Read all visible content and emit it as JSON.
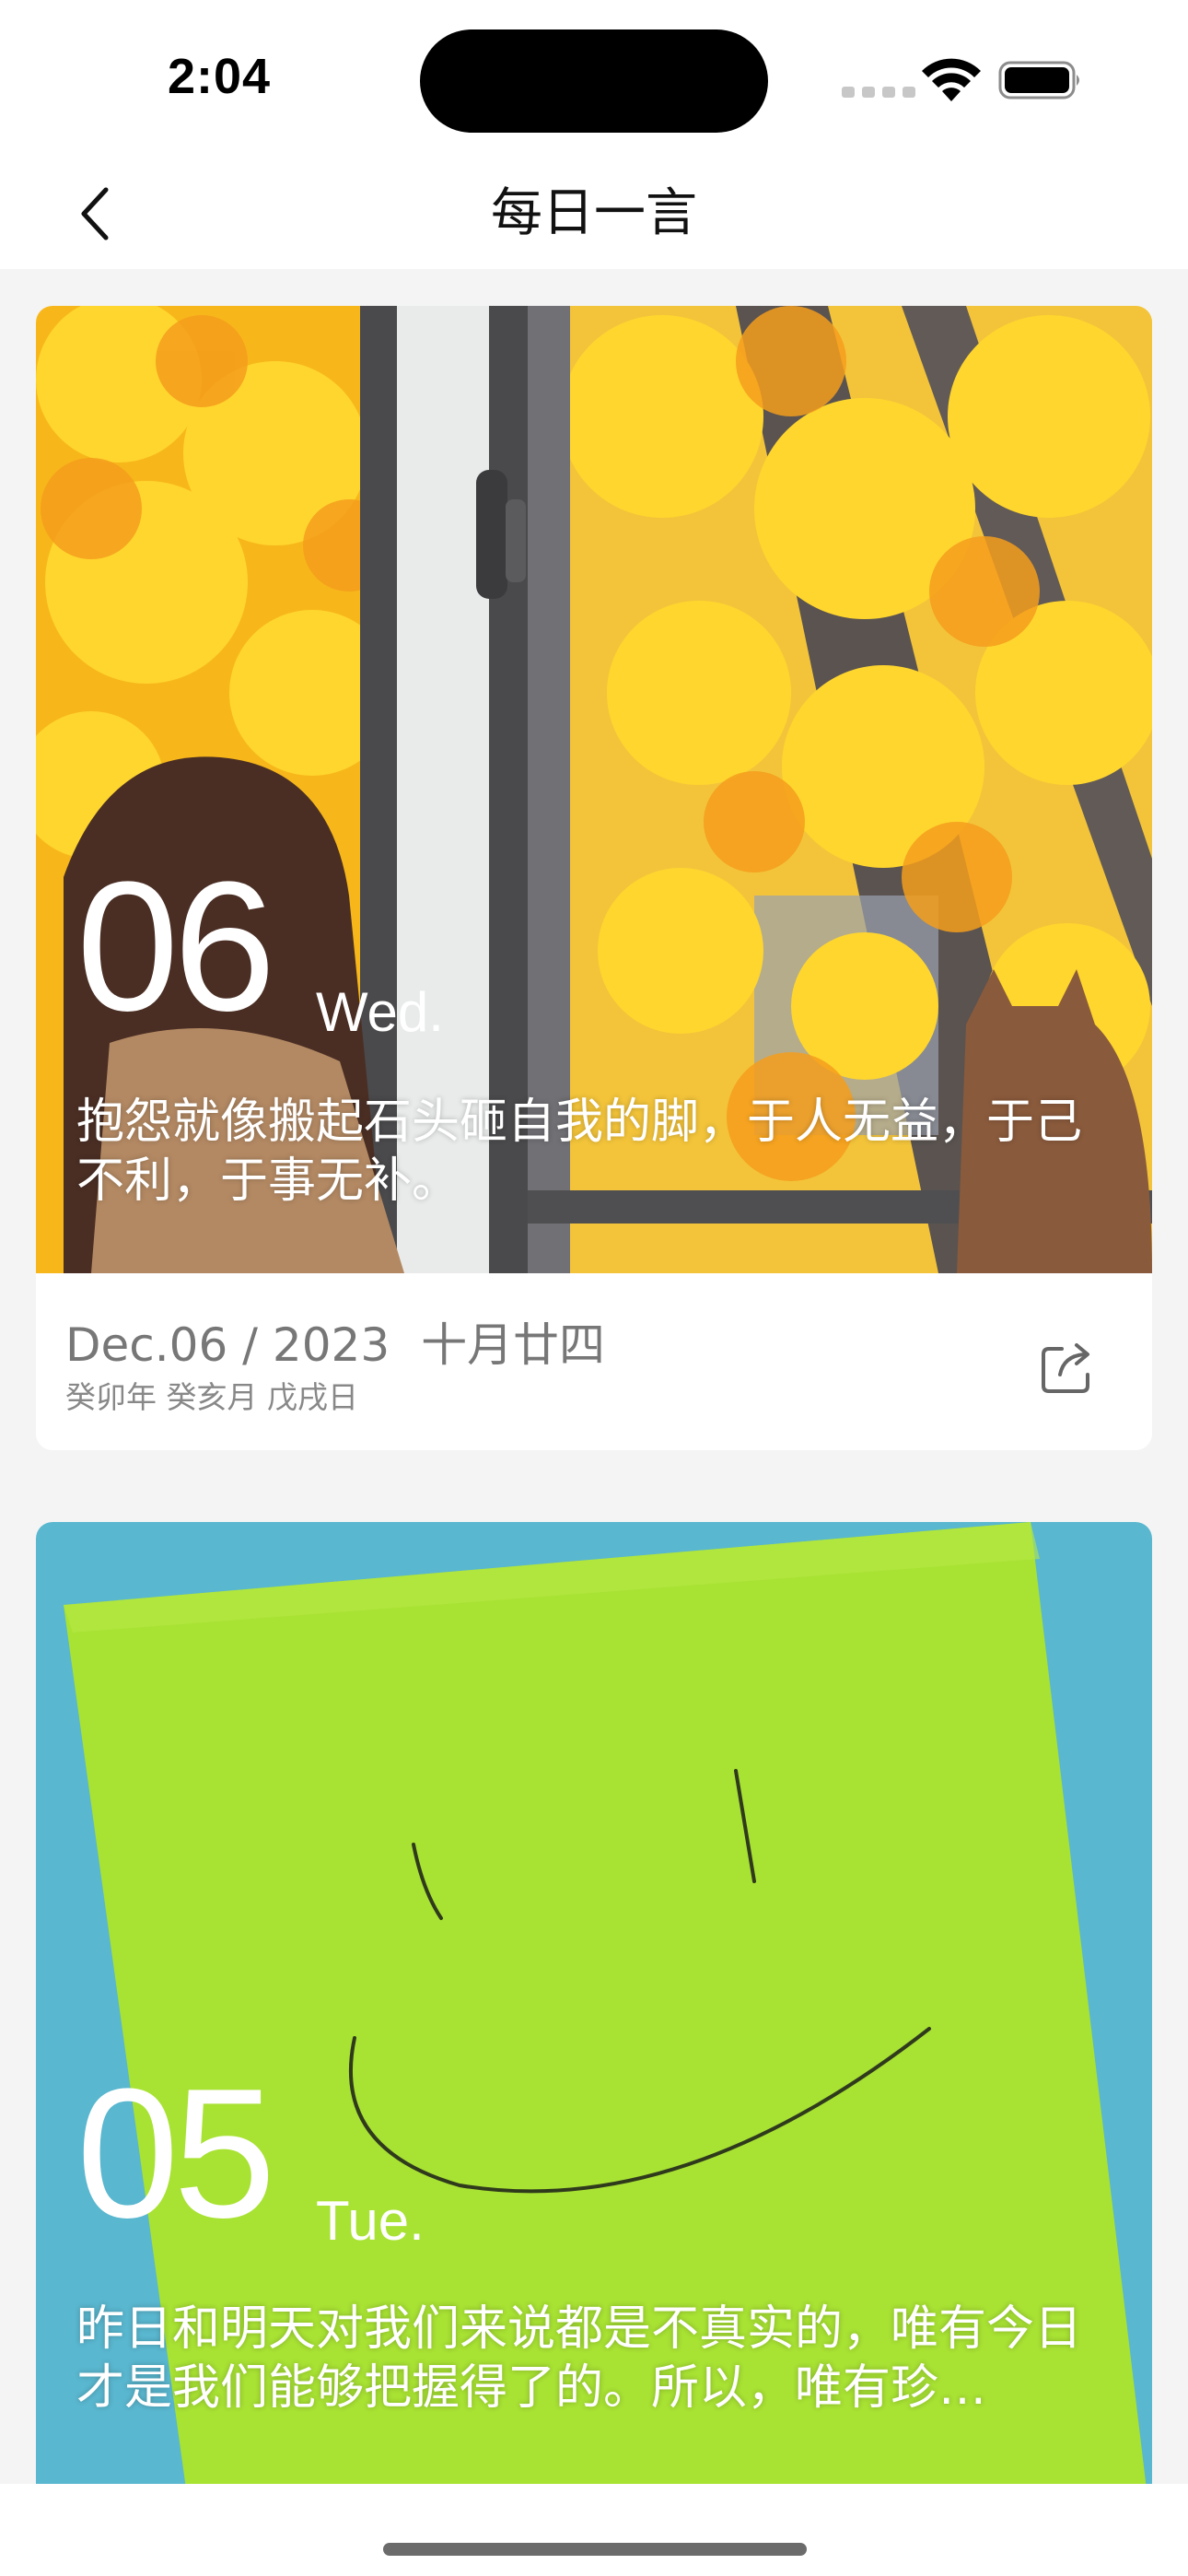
{
  "status_bar": {
    "time": "2:04"
  },
  "nav": {
    "title": "每日一言",
    "back_icon": "chevron-left-icon"
  },
  "cards": [
    {
      "day": "06",
      "weekday": "Wed.",
      "quote": "抱怨就像搬起石头砸自我的脚，于人无益，于己不利，于事无补。",
      "date": "Dec.06 / 2023",
      "lunar_date": "十月廿四",
      "ganzhi": "癸卯年 癸亥月 戊戌日",
      "share_icon": "share-icon",
      "image_desc_colors": {
        "leaves": "#f9c21a",
        "frame": "#4a4a4c"
      }
    },
    {
      "day": "05",
      "weekday": "Tue.",
      "quote": "昨日和明天对我们来说都是不真实的，唯有今日才是我们能够把握得了的。所以，唯有珍…",
      "image_desc_colors": {
        "note": "#a8e233",
        "background": "#59b7cf"
      }
    }
  ]
}
